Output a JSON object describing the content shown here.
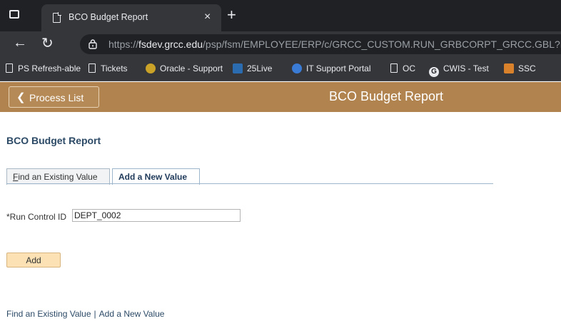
{
  "browser": {
    "tab_title": "BCO Budget Report",
    "tab_close": "×",
    "new_tab": "+",
    "url_prefix": "https://",
    "url_host": "fsdev.grcc.edu",
    "url_path": "/psp/fsm/EMPLOYEE/ERP/c/GRCC_CUSTOM.RUN_GRBCORPT_GRCC.GBL?R..."
  },
  "bookmarks": [
    {
      "label": "PS Refresh-able",
      "icon": "page-icon"
    },
    {
      "label": "Tickets",
      "icon": "page-icon"
    },
    {
      "label": "Oracle - Support",
      "icon": "oracle-icon"
    },
    {
      "label": "25Live",
      "icon": "25live-icon"
    },
    {
      "label": "IT Support Portal",
      "icon": "portal-icon"
    },
    {
      "label": "OC",
      "icon": "page-icon"
    },
    {
      "label": "CWIS - Test",
      "icon": "google-icon"
    },
    {
      "label": "SSC",
      "icon": "ssc-icon"
    }
  ],
  "header": {
    "back_button": "Process List",
    "title": "BCO Budget Report",
    "color": "#b0834f"
  },
  "page": {
    "title": "BCO Budget Report",
    "tabs": [
      {
        "label": "Find an Existing Value",
        "first_letter": "F",
        "rest": "ind an Existing Value"
      },
      {
        "label": "Add a New Value"
      }
    ],
    "run_control_label": "*Run Control ID",
    "run_control_value": "DEPT_0002",
    "add_button": "Add",
    "footer": {
      "link1": "Find an Existing Value",
      "separator": "|",
      "link2": "Add a New Value"
    }
  }
}
